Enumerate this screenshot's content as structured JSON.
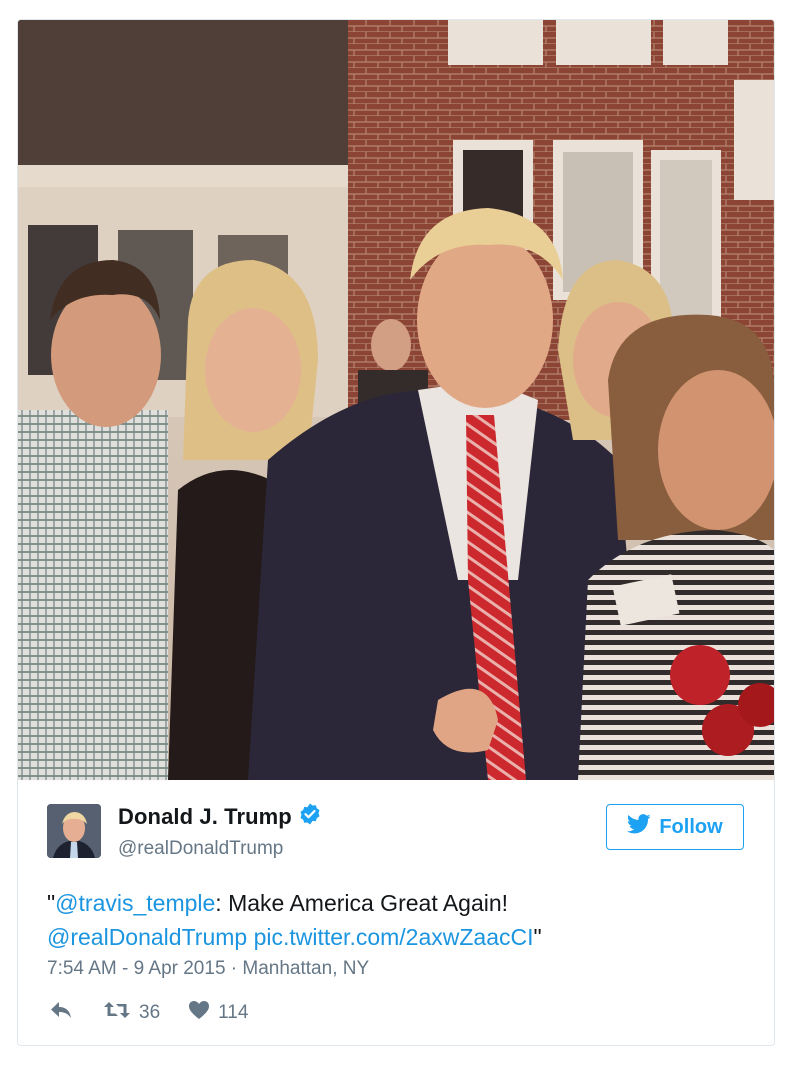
{
  "tweet": {
    "author": {
      "display_name": "Donald J. Trump",
      "handle": "@realDonaldTrump",
      "verified": true
    },
    "follow_label": "Follow",
    "text": {
      "open_quote": "\"",
      "mention": "@travis_temple",
      "body": ": Make America Great Again!",
      "mention2": "@realDonaldTrump",
      "pic_link": "pic.twitter.com/2axwZaacCI",
      "close_quote": "\""
    },
    "timestamp": "7:54 AM - 9 Apr 2015",
    "separator": "·",
    "location": "Manhattan, NY",
    "retweet_count": "36",
    "like_count": "114"
  },
  "colors": {
    "twitter_blue": "#1da1f2",
    "link": "#1b95e0",
    "text": "#14171a",
    "secondary": "#657786",
    "border": "#e1e8ed"
  },
  "icons": [
    "verified-badge-icon",
    "bird-icon",
    "reply-icon",
    "retweet-icon",
    "heart-icon"
  ]
}
